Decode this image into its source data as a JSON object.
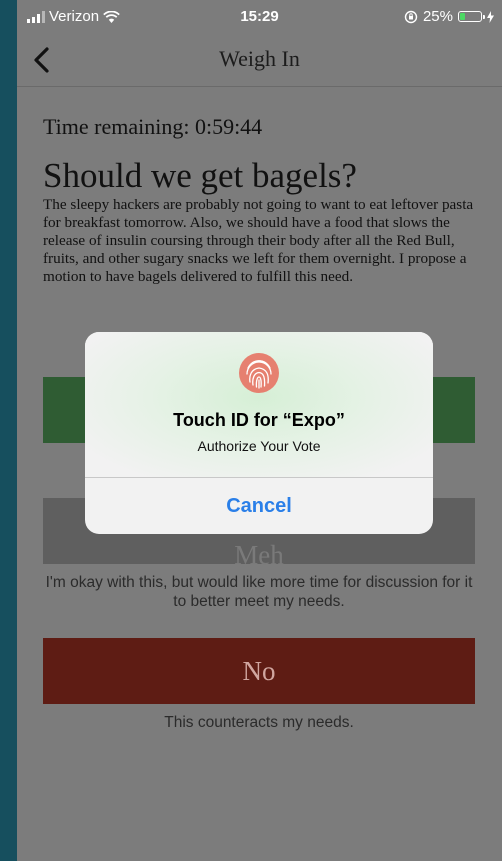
{
  "status_bar": {
    "carrier": "Verizon",
    "time": "15:29",
    "battery": "25%",
    "battery_level": 0.25
  },
  "nav": {
    "title": "Weigh In"
  },
  "proposal": {
    "time_remaining": "Time remaining: 0:59:44",
    "title": "Should we get bagels?",
    "body": "The sleepy hackers are probably not going to want to eat leftover pasta for breakfast tomorrow. Also, we should have a food that slows the release of insulin coursing through their body after all the Red Bull, fruits, and other sugary snacks we left for them overnight. I propose a motion to have bagels delivered to fulfill this need."
  },
  "votes": {
    "meh_label": "Meh",
    "meh_description": "I'm okay with this, but would like more time for discussion for it to better meet my needs.",
    "no_label": "No",
    "no_description": "This counteracts my needs."
  },
  "alert": {
    "title": "Touch ID for “Expo”",
    "message": "Authorize Your Vote",
    "cancel_label": "Cancel"
  },
  "colors": {
    "yes": "#2f5c33",
    "meh": "#5f5f5f",
    "no": "#5e1c14",
    "accent": "#2a7fe8"
  }
}
